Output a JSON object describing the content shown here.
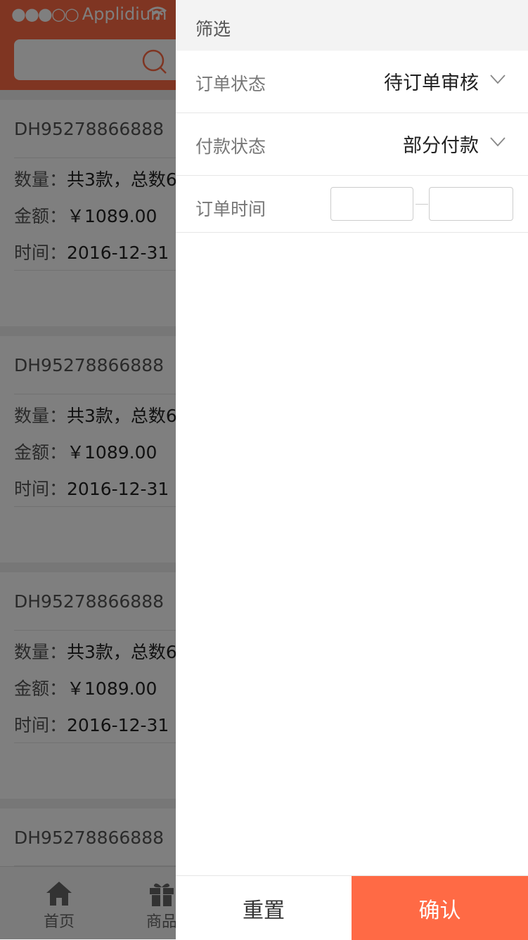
{
  "status_bar": {
    "signal": "●●●○○",
    "carrier": "Applidium"
  },
  "orders": [
    {
      "id": "DH95278866888",
      "qty_label": "数量：",
      "qty_value": "共3款，总数6",
      "amount_label": "金额：",
      "amount_value": "￥1089.00",
      "time_label": "时间：",
      "time_value": "2016-12-31"
    },
    {
      "id": "DH95278866888",
      "qty_label": "数量：",
      "qty_value": "共3款，总数6",
      "amount_label": "金额：",
      "amount_value": "￥1089.00",
      "time_label": "时间：",
      "time_value": "2016-12-31"
    },
    {
      "id": "DH95278866888",
      "qty_label": "数量：",
      "qty_value": "共3款，总数6",
      "amount_label": "金额：",
      "amount_value": "￥1089.00",
      "time_label": "时间：",
      "time_value": "2016-12-31"
    },
    {
      "id": "DH95278866888"
    }
  ],
  "tabbar": {
    "items": [
      {
        "label": "首页",
        "icon": "home-icon"
      },
      {
        "label": "商品",
        "icon": "gift-icon"
      }
    ]
  },
  "filter": {
    "title": "筛选",
    "order_status": {
      "label": "订单状态",
      "value": "待订单审核"
    },
    "payment_status": {
      "label": "付款状态",
      "value": "部分付款"
    },
    "order_time": {
      "label": "订单时间",
      "start": "",
      "end": ""
    },
    "reset_label": "重置",
    "confirm_label": "确认"
  },
  "colors": {
    "accent": "#ff6a45",
    "overlay": "rgba(0,0,0,0.5)"
  }
}
